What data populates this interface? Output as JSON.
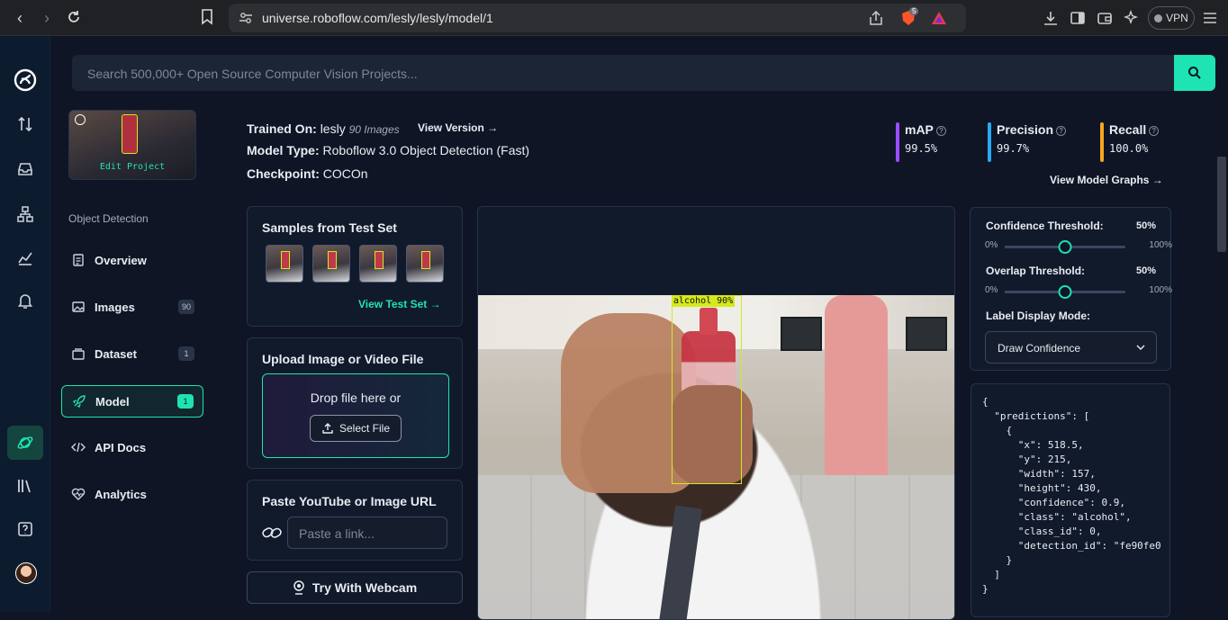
{
  "browser": {
    "url": "universe.roboflow.com/lesly/lesly/model/1",
    "shield_count": "5",
    "vpn_label": "VPN"
  },
  "search": {
    "placeholder": "Search 500,000+ Open Source Computer Vision Projects..."
  },
  "project": {
    "edit_label": "Edit Project",
    "type_label": "Object Detection"
  },
  "nav": [
    {
      "label": "Overview",
      "badge": ""
    },
    {
      "label": "Images",
      "badge": "90"
    },
    {
      "label": "Dataset",
      "badge": "1"
    },
    {
      "label": "Model",
      "badge": "1"
    },
    {
      "label": "API Docs",
      "badge": ""
    },
    {
      "label": "Analytics",
      "badge": ""
    }
  ],
  "model_info": {
    "trained_on_label": "Trained On:",
    "trained_on_value": "lesly",
    "images_count": "90 Images",
    "view_version": "View Version →",
    "model_type_label": "Model Type:",
    "model_type_value": "Roboflow 3.0 Object Detection (Fast)",
    "checkpoint_label": "Checkpoint:",
    "checkpoint_value": "COCOn"
  },
  "metrics": [
    {
      "name": "mAP",
      "value": "99.5%",
      "color": "#9b4dff"
    },
    {
      "name": "Precision",
      "value": "99.7%",
      "color": "#2aa8f2"
    },
    {
      "name": "Recall",
      "value": "100.0%",
      "color": "#f5a623"
    }
  ],
  "view_graphs": "View Model Graphs →",
  "samples": {
    "title": "Samples from Test Set",
    "link": "View Test Set →"
  },
  "upload": {
    "title": "Upload Image or Video File",
    "drop_text": "Drop file here or",
    "select_label": "Select File"
  },
  "paste": {
    "title": "Paste YouTube or Image URL",
    "placeholder": "Paste a link..."
  },
  "webcam_label": "Try With Webcam",
  "detection": {
    "label": "alcohol 90%"
  },
  "controls": {
    "confidence_label": "Confidence Threshold:",
    "confidence_value": "50%",
    "confidence_level": 0.5,
    "overlap_label": "Overlap Threshold:",
    "overlap_value": "50%",
    "overlap_level": 0.5,
    "min": "0%",
    "max": "100%",
    "display_mode_label": "Label Display Mode:",
    "display_mode_value": "Draw Confidence"
  },
  "json_output": "{\n  \"predictions\": [\n    {\n      \"x\": 518.5,\n      \"y\": 215,\n      \"width\": 157,\n      \"height\": 430,\n      \"confidence\": 0.9,\n      \"class\": \"alcohol\",\n      \"class_id\": 0,\n      \"detection_id\": \"fe90fe0\n    }\n  ]\n}",
  "colors": {
    "accent": "#1ee3b2",
    "bbox": "#d4ea1c"
  }
}
